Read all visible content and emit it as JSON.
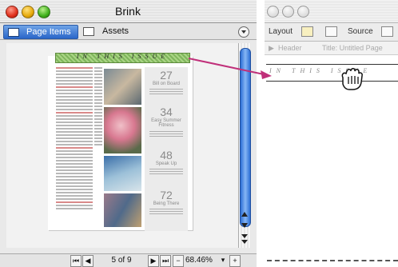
{
  "left_window": {
    "title": "Brink",
    "tabs": [
      {
        "label": "Page Items",
        "selected": true
      },
      {
        "label": "Assets",
        "selected": false
      }
    ],
    "page": {
      "banner_text": "IN THIS ISSUE",
      "items": [
        {
          "number": "27",
          "title": "Bill on Board"
        },
        {
          "number": "34",
          "title": "Easy Summer Fitness"
        },
        {
          "number": "48",
          "title": "Speak Up"
        },
        {
          "number": "72",
          "title": "Being There"
        }
      ]
    },
    "status": {
      "page_indicator": "5 of 9",
      "zoom": "68.46%"
    }
  },
  "right_window": {
    "toolbar": {
      "layout_label": "Layout",
      "source_label": "Source"
    },
    "subbar": {
      "header_label": "Header",
      "title_label": "Title: Untitled Page"
    },
    "bar_text": "IN THIS ISSUE"
  },
  "colors": {
    "accent": "#2c6fd6",
    "banner_green": "#a9d484",
    "arrow": "#c0307a"
  }
}
